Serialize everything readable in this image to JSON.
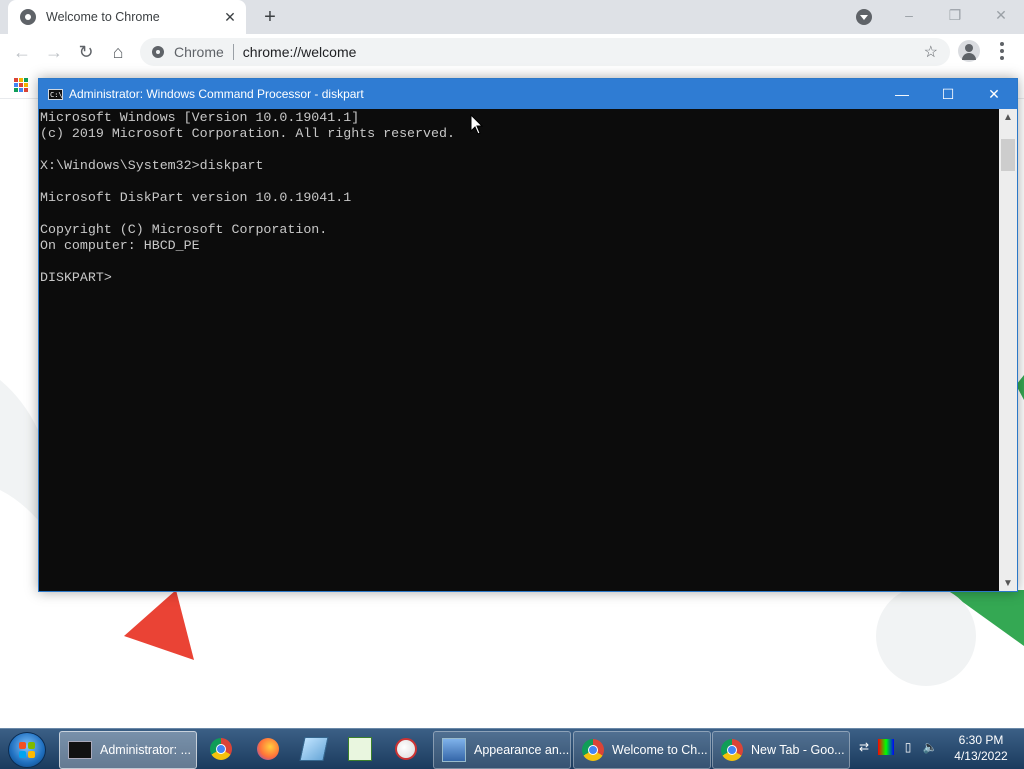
{
  "browser": {
    "tab_title": "Welcome to Chrome",
    "tab_close": "✕",
    "new_tab": "+",
    "omnibox_chip": "Chrome",
    "omnibox_url": "chrome://welcome",
    "back": "←",
    "forward": "→",
    "reload": "↻",
    "home": "⌂",
    "star": "☆",
    "win_minimize": "–",
    "win_restore": "❐",
    "win_close": "✕",
    "apps_colors": [
      "#db4437",
      "#f4b400",
      "#0f9d58",
      "#4285f4",
      "#db4437",
      "#f4b400",
      "#0f9d58",
      "#4285f4",
      "#db4437"
    ]
  },
  "console": {
    "title": "Administrator: Windows Command Processor - diskpart",
    "icon_text": "C:\\",
    "minimize": "—",
    "maximize": "☐",
    "close": "✕",
    "lines": [
      "Microsoft Windows [Version 10.0.19041.1]",
      "(c) 2019 Microsoft Corporation. All rights reserved.",
      "",
      "X:\\Windows\\System32>diskpart",
      "",
      "Microsoft DiskPart version 10.0.19041.1",
      "",
      "Copyright (C) Microsoft Corporation.",
      "On computer: HBCD_PE",
      "",
      "DISKPART>"
    ],
    "scroll_up": "▲",
    "scroll_down": "▼"
  },
  "taskbar": {
    "items": [
      {
        "label": "Administrator: ...",
        "icon": "cmd-icon"
      },
      {
        "label": "",
        "icon": "chrome-icon"
      },
      {
        "label": "",
        "icon": "firefox-icon"
      },
      {
        "label": "",
        "icon": "notepad-icon"
      },
      {
        "label": "",
        "icon": "spreadsheet-icon"
      },
      {
        "label": "",
        "icon": "paint-icon"
      },
      {
        "label": "Appearance an...",
        "icon": "appearance-icon"
      },
      {
        "label": "Welcome to Ch...",
        "icon": "chrome-icon"
      },
      {
        "label": "New Tab - Goo...",
        "icon": "chrome-icon"
      }
    ],
    "clock_time": "6:30 PM",
    "clock_date": "4/13/2022",
    "flag_colors": [
      "#f25022",
      "#7fba00",
      "#00a4ef",
      "#ffb900"
    ]
  },
  "colors": {
    "console_bg": "#0c0c0c",
    "console_text": "#c8c8c8",
    "console_titlebar": "#2f7cd3",
    "deco_red": "#ea4335",
    "deco_green": "#34a853"
  }
}
